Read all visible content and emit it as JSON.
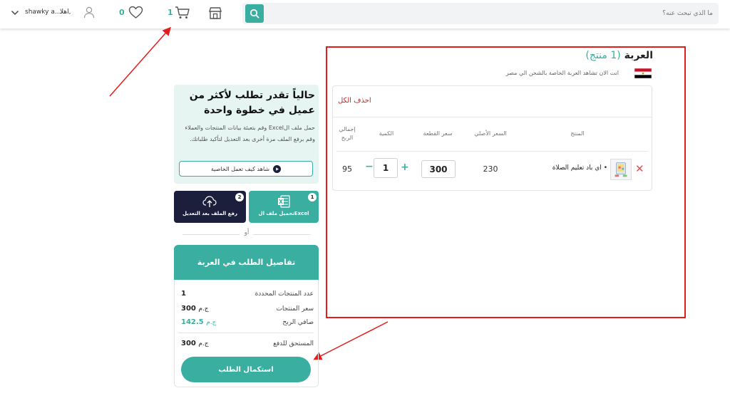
{
  "header": {
    "search_placeholder": "ما الذي تبحث عنه؟",
    "user_greeting": "اهلا,",
    "user_name": "shawky a...",
    "wishlist_count": "0",
    "cart_count": "1",
    "accent_color": "#3aaea0",
    "icons": [
      "search-icon",
      "store-icon",
      "cart-icon",
      "heart-icon",
      "user-icon",
      "chevron-down-icon"
    ]
  },
  "cart": {
    "title": "العربة",
    "count_label": "(1 منتج)",
    "subtitle": "انت الان تشاهد العربة الخاصة بالشحن الي مصر",
    "delete_all": "احذف الكل",
    "columns": {
      "product": "المنتج",
      "original_price": "السعر الأصلي",
      "unit_price": "سعر القطعة",
      "quantity": "الكمية",
      "total_profit": "إجمالي الربح"
    },
    "items": [
      {
        "name": "• اي باد تعليم الصلاة",
        "original_price": "230",
        "unit_price": "300",
        "quantity": "1",
        "total_profit": "95"
      }
    ]
  },
  "promo": {
    "title": "حالياً تقدر تطلب لأكثر من عميل في خطوة واحدة",
    "text": "حمل ملف الExcel وقم بتعبئة بيانات المنتجات والعملاء وقم برفع الملف مرة أخرى بعد التعديل لتأكيد طلباتك.",
    "watch_button": "شاهد كيف تعمل الخاصية",
    "step1_num": "1",
    "step1_label": "تحميل ملف الExcel",
    "step2_num": "2",
    "step2_label": "رفع الملف بعد التعديل",
    "or": "أو"
  },
  "summary": {
    "title": "تفاصيل الطلب في العربة",
    "selected_count_label": "عدد المنتجات المحددة",
    "selected_count": "1",
    "products_price_label": "سعر المنتجات",
    "products_price": "300",
    "net_profit_label": "صافي الربح",
    "net_profit": "142.5",
    "due_label": "المستحق للدفع",
    "due": "300",
    "currency": "ج.م",
    "checkout_button": "استكمال الطلب"
  }
}
